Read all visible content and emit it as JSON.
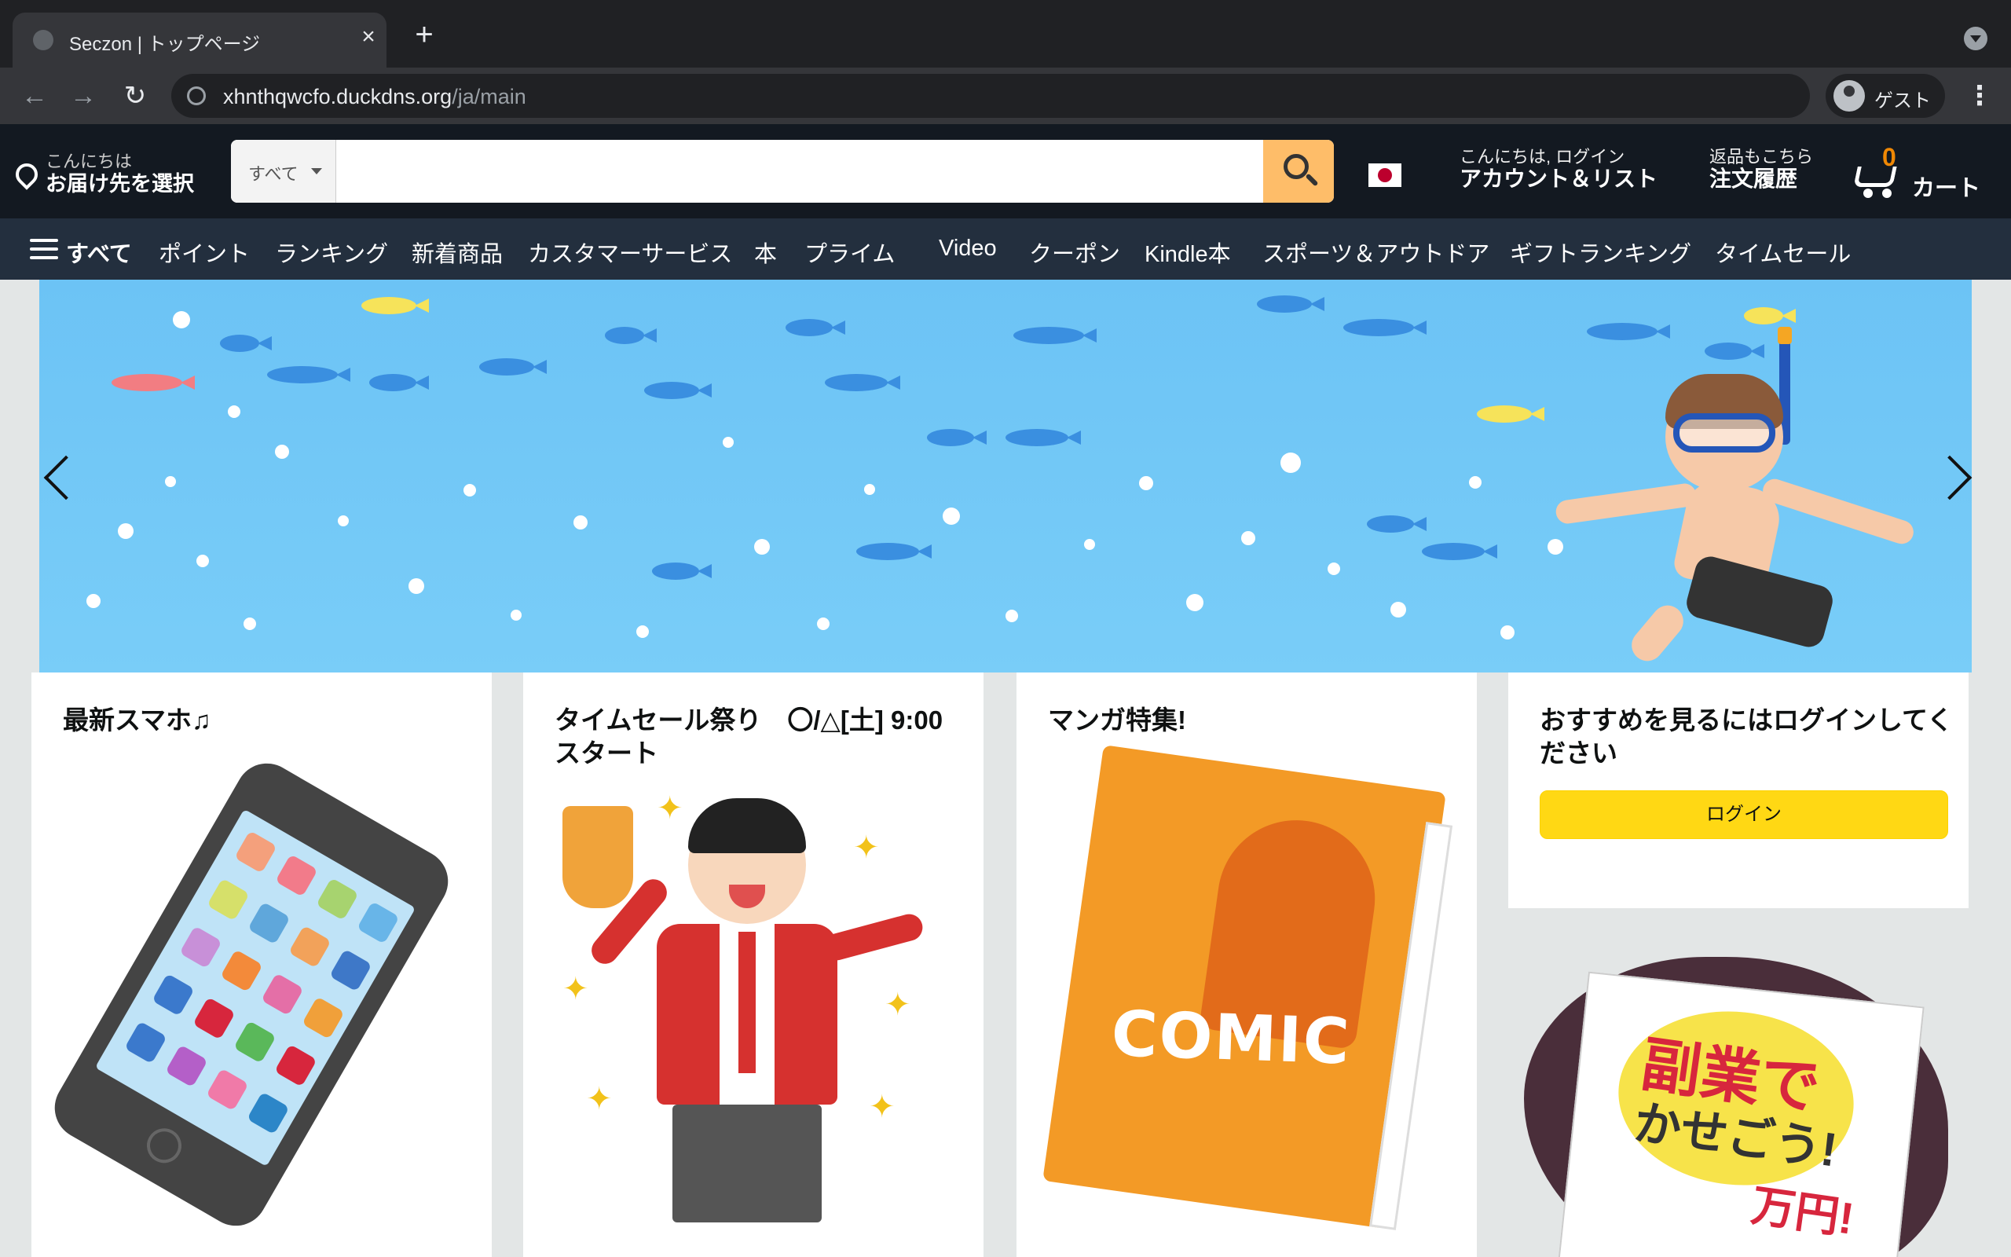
{
  "browser": {
    "tab_title": "Seczon | トップページ",
    "url_host": "xhnthqwcfo.duckdns.org",
    "url_path": "/ja/main",
    "profile_label": "ゲスト",
    "icons": [
      "back-icon",
      "forward-icon",
      "reload-icon",
      "globe-icon",
      "close-icon",
      "plus-icon",
      "kebab-icon"
    ]
  },
  "header": {
    "deliver_line1": "こんにちは",
    "deliver_line2": "お届け先を選択",
    "search_category": "すべて",
    "search_placeholder": "",
    "account_line1": "こんにちは, ログイン",
    "account_line2": "アカウント＆リスト",
    "returns_line1": "返品もこちら",
    "returns_line2": "注文履歴",
    "cart_count": "0",
    "cart_label": "カート"
  },
  "nav": {
    "all_label": "すべて",
    "items": [
      "ポイント",
      "ランキング",
      "新着商品",
      "カスタマーサービス",
      "本",
      "プライム",
      "Video",
      "クーポン",
      "Kindle本",
      "スポーツ＆アウトドア",
      "ギフトランキング",
      "タイムセール"
    ]
  },
  "cards": [
    {
      "title": "最新スマホ♫"
    },
    {
      "title": "タイムセール祭り　〇/△[土] 9:00スタート"
    },
    {
      "title": "マンガ特集!"
    },
    {
      "title": "おすすめを見るにはログインしてください",
      "button": "ログイン"
    }
  ],
  "images": {
    "comic_text": "COMIC",
    "flyer_line1": "副業で",
    "flyer_line2": "かせごう!",
    "flyer_line3": "万円!"
  },
  "colors": {
    "header_bg": "#131921",
    "nav_bg": "#232f3e",
    "search_button": "#febd69",
    "cart_count": "#f08804",
    "login_button": "#ffd814"
  }
}
